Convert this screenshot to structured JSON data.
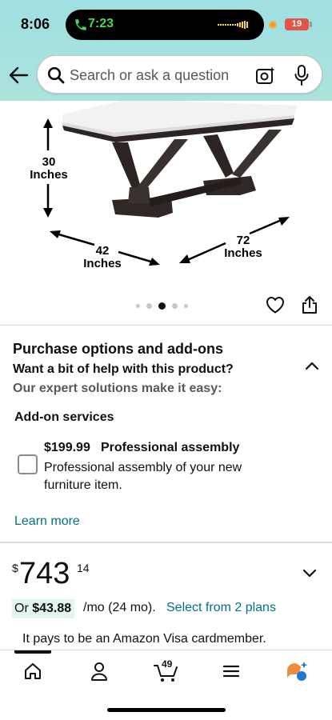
{
  "status_bar": {
    "time": "8:06",
    "call_time": "7:23",
    "battery": "19"
  },
  "search": {
    "placeholder": "Search or ask a question"
  },
  "product_image": {
    "height_label_line1": "30",
    "height_label_line2": "Inches",
    "width_label_line1": "42",
    "width_label_line2": "Inches",
    "length_label_line1": "72",
    "length_label_line2": "Inches"
  },
  "carousel": {
    "count": 5,
    "active_index": 2
  },
  "purchase_options": {
    "title": "Purchase options and add-ons",
    "subtitle": "Want a bit of help with this product?",
    "tagline": "Our expert solutions make it easy:",
    "addon_heading": "Add-on services",
    "addon": {
      "price": "$199.99",
      "name": "Professional assembly",
      "description": "Professional assembly of your new furniture item.",
      "checked": false
    },
    "learn_more": "Learn more"
  },
  "price": {
    "symbol": "$",
    "whole": "743",
    "fraction": "14"
  },
  "financing": {
    "prefix": "Or ",
    "monthly": "$43.88",
    "term": "/mo (24 mo).",
    "plans_link": "Select from 2 plans"
  },
  "promo": {
    "visa_text": "It pays to be an Amazon Visa cardmember."
  },
  "tabbar": {
    "cart_count": "49"
  },
  "colors": {
    "header_bg": "#a5e1df",
    "link": "#007185",
    "badge_bg": "#e3f6ee",
    "rufus_orange": "#f08a3e",
    "rufus_blue": "#1f78d6"
  }
}
